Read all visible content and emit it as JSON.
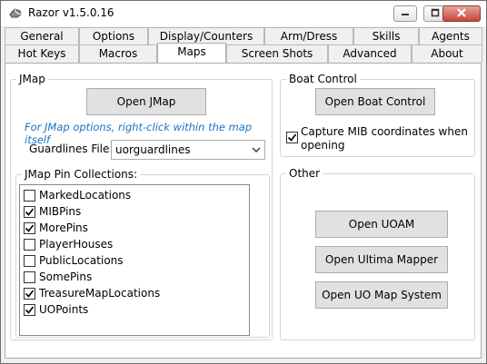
{
  "window": {
    "title": "Razor v1.5.0.16"
  },
  "tabs_row_back": [
    {
      "label": "General"
    },
    {
      "label": "Options"
    },
    {
      "label": "Display/Counters"
    },
    {
      "label": "Arm/Dress"
    },
    {
      "label": "Skills"
    },
    {
      "label": "Agents"
    }
  ],
  "tabs_row_front": [
    {
      "label": "Hot Keys"
    },
    {
      "label": "Macros"
    },
    {
      "label": "Maps",
      "active": true
    },
    {
      "label": "Screen Shots"
    },
    {
      "label": "Advanced"
    },
    {
      "label": "About"
    }
  ],
  "jmap": {
    "group_title": "JMap",
    "open_button": "Open JMap",
    "hint": "For JMap options, right-click within the map itself",
    "guardlines_label": "Guardlines File:",
    "guardlines_value": "uorguardlines"
  },
  "pins": {
    "group_title": "JMap Pin Collections:",
    "items": [
      {
        "label": "MarkedLocations",
        "checked": false
      },
      {
        "label": "MIBPins",
        "checked": true
      },
      {
        "label": "MorePins",
        "checked": true
      },
      {
        "label": "PlayerHouses",
        "checked": false
      },
      {
        "label": "PublicLocations",
        "checked": false
      },
      {
        "label": "SomePins",
        "checked": false
      },
      {
        "label": "TreasureMapLocations",
        "checked": true
      },
      {
        "label": "UOPoints",
        "checked": true
      }
    ]
  },
  "boat": {
    "group_title": "Boat Control",
    "open_button": "Open Boat Control",
    "capture_line1": "Capture MIB coordinates when",
    "capture_line2": "opening",
    "capture_checked": true
  },
  "other": {
    "group_title": "Other",
    "buttons": [
      {
        "label": "Open UOAM"
      },
      {
        "label": "Open Ultima Mapper"
      },
      {
        "label": "Open UO Map System"
      }
    ]
  }
}
